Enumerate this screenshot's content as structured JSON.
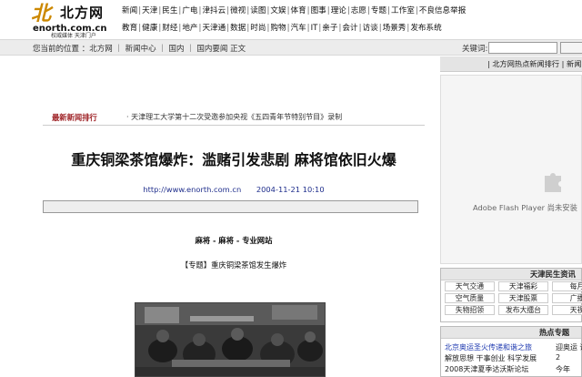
{
  "header": {
    "logo_mark": "北",
    "logo_name": "北方网",
    "logo_domain": "enorth.com.cn",
    "logo_tagline": "权威媒体 天津门户",
    "nav_row1": [
      "新闻",
      "天津",
      "民生",
      "广电",
      "津抖云",
      "微视",
      "读图",
      "文娱",
      "体育",
      "图事",
      "理论",
      "志愿",
      "专题",
      "工作室",
      "不良信息举报"
    ],
    "nav_row2": [
      "教育",
      "健康",
      "财经",
      "地产",
      "天津通",
      "数据",
      "时尚",
      "购物",
      "汽车",
      "IT",
      "亲子",
      "会计",
      "访谈",
      "场景秀",
      "发布系统"
    ]
  },
  "locbar": {
    "text": "您当前的位置 ：北方网 ｜ 新闻中心 ｜ 国内 ｜ 国内要闻 正文",
    "keyword_label": "关键词:",
    "keyword_value": "",
    "search_label": ""
  },
  "ticker": {
    "label": "最新新闻排行",
    "text": "· 天津理工大学第十二次受邀参加央视《五四青年节特别节目》录制"
  },
  "article": {
    "title": "重庆铜梁茶馆爆炸：滥赌引发悲剧 麻将馆依旧火爆",
    "url": "http://www.enorth.com.cn",
    "datetime": "2004-11-21 10:10",
    "line1": "麻将 - 麻将 - 专业网站",
    "line2": "【专题】重庆铜梁茶馆发生爆炸"
  },
  "sidebar": {
    "header_text": "| 北方网热点新闻排行 | 新闻",
    "flash_message": "Adobe Flash Player 尚未安装",
    "minsheng_title": "天津民生资讯",
    "minsheng": [
      [
        "天气交通",
        "天津福彩",
        "每月"
      ],
      [
        "空气质量",
        "天津股票",
        "广播"
      ],
      [
        "失物招领",
        "发布大擂台",
        "天视"
      ]
    ],
    "hot_title": "热点专题",
    "hot_items": [
      {
        "left": "北京奥运圣火传递和谐之旅",
        "right": "迎奥运 讲"
      },
      {
        "left": "解放思想 干事创业 科学发展",
        "right": "2"
      },
      {
        "left": "2008天津夏季达沃斯论坛",
        "right": "今年"
      }
    ]
  }
}
